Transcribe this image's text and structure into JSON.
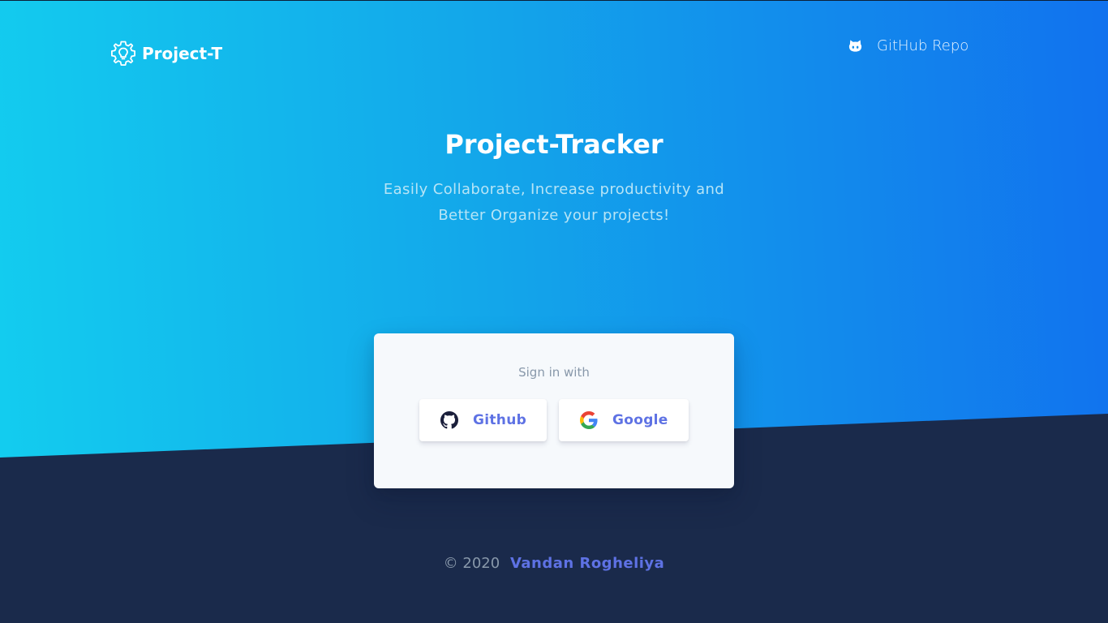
{
  "nav": {
    "brand": "Project-T",
    "repo_link": "GitHub Repo"
  },
  "hero": {
    "title": "Project-Tracker",
    "subtitle": "Easily Collaborate, Increase productivity and Better Organize your projects!"
  },
  "signin": {
    "label": "Sign in with",
    "github_label": "Github",
    "google_label": "Google"
  },
  "footer": {
    "copyright": "© 2020",
    "author": "Vandan Rogheliya"
  },
  "colors": {
    "gradient_start": "#13cdef",
    "gradient_end": "#1172ee",
    "dark_bg": "#1a2a4b",
    "accent": "#5e72e4",
    "card_bg": "#f6f9fc",
    "muted_text": "#8898aa"
  },
  "icons": {
    "brand": "gear-bulb-icon",
    "repo": "github-octocat-icon",
    "github_button": "github-icon",
    "google_button": "google-icon"
  }
}
